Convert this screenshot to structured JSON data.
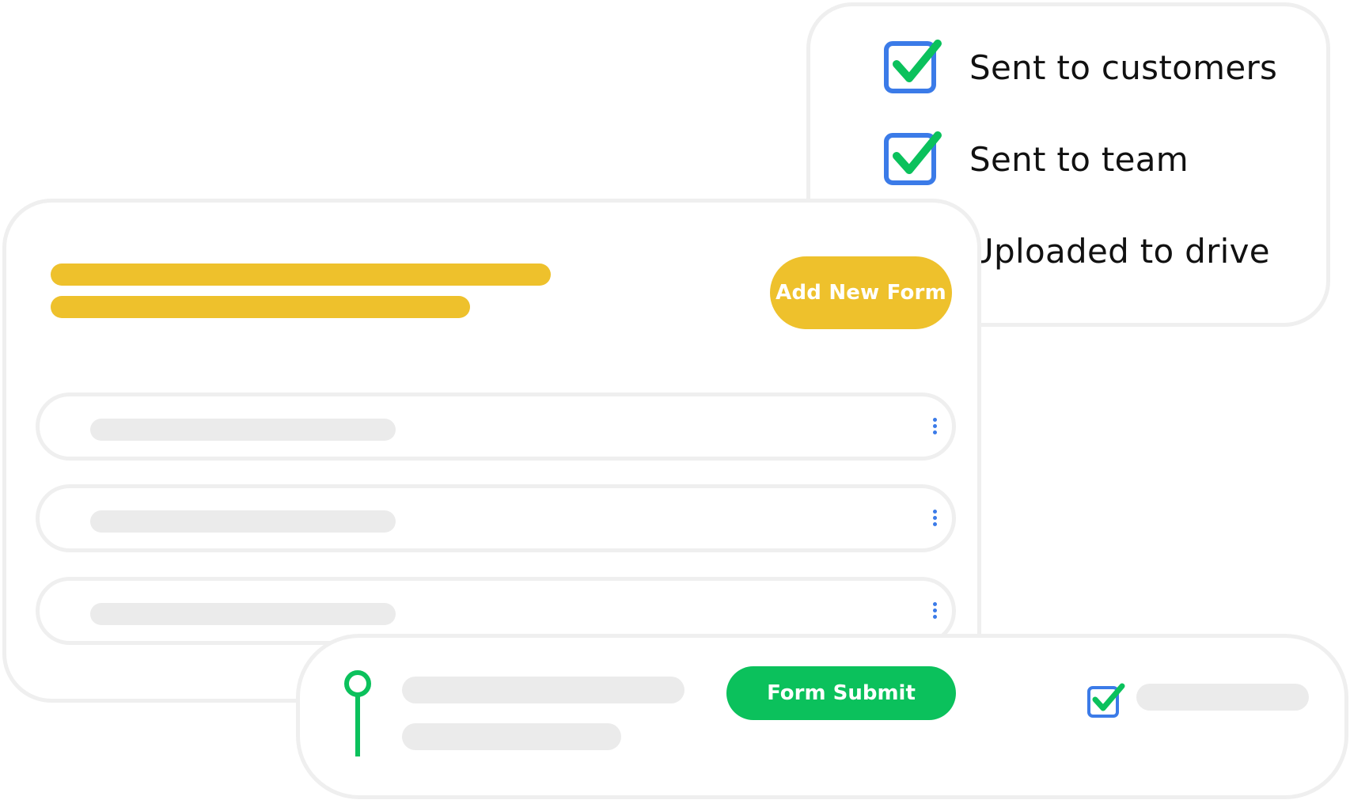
{
  "checklist": {
    "items": [
      {
        "label": "Sent to customers",
        "checked": true
      },
      {
        "label": "Sent to team",
        "checked": true
      },
      {
        "label": "Uploaded to drive",
        "checked": true
      }
    ]
  },
  "forms_panel": {
    "add_button_label": "Add New Form",
    "rows": [
      {
        "menu_icon": "more-vertical-icon"
      },
      {
        "menu_icon": "more-vertical-icon"
      },
      {
        "menu_icon": "more-vertical-icon"
      }
    ]
  },
  "submission": {
    "submit_button_label": "Form Submit",
    "status_checked": true
  },
  "colors": {
    "accent_yellow": "#eec12c",
    "accent_green": "#0bc15c",
    "checkbox_blue": "#3b7be8",
    "placeholder_gray": "#ebebeb",
    "border_gray": "#efefef"
  },
  "icons": {
    "checkbox": "checkbox-checked-icon",
    "row_menu": "more-vertical-icon",
    "timeline": "pin-icon"
  }
}
